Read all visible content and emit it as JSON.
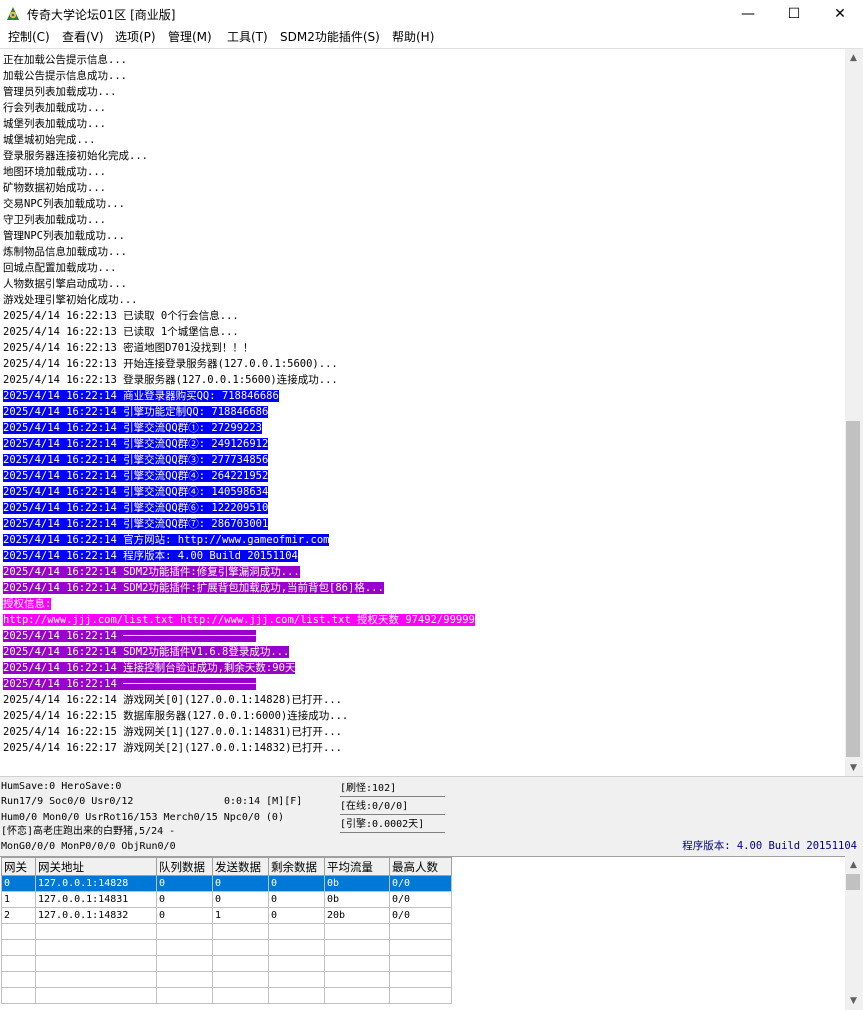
{
  "window": {
    "title": "传奇大学论坛01区 [商业版]",
    "min_glyph": "—",
    "max_glyph": "☐",
    "close_glyph": "✕"
  },
  "menu": [
    "控制(C)",
    "查看(V)",
    "选项(P)",
    "管理(M)",
    "工具(T)",
    "SDM2功能插件(S)",
    "帮助(H)"
  ],
  "log": [
    {
      "text": "正在加载公告提示信息...",
      "style": ""
    },
    {
      "text": "加载公告提示信息成功...",
      "style": ""
    },
    {
      "text": "管理员列表加载成功...",
      "style": ""
    },
    {
      "text": "行会列表加载成功...",
      "style": ""
    },
    {
      "text": "城堡列表加载成功...",
      "style": ""
    },
    {
      "text": "城堡城初始完成...",
      "style": ""
    },
    {
      "text": "登录服务器连接初始化完成...",
      "style": ""
    },
    {
      "text": "地图环境加载成功...",
      "style": ""
    },
    {
      "text": "矿物数据初始成功...",
      "style": ""
    },
    {
      "text": "交易NPC列表加载成功...",
      "style": ""
    },
    {
      "text": "守卫列表加载成功...",
      "style": ""
    },
    {
      "text": "管理NPC列表加载成功...",
      "style": ""
    },
    {
      "text": "炼制物品信息加载成功...",
      "style": ""
    },
    {
      "text": "回城点配置加载成功...",
      "style": ""
    },
    {
      "text": "人物数据引擎启动成功...",
      "style": ""
    },
    {
      "text": "游戏处理引擎初始化成功...",
      "style": ""
    },
    {
      "text": "2025/4/14 16:22:13 已读取 0个行会信息...",
      "style": ""
    },
    {
      "text": "2025/4/14 16:22:13 已读取 1个城堡信息...",
      "style": ""
    },
    {
      "text": "2025/4/14 16:22:13 密道地图D701没找到！！！",
      "style": ""
    },
    {
      "text": "2025/4/14 16:22:13 开始连接登录服务器(127.0.0.1:5600)...",
      "style": ""
    },
    {
      "text": "2025/4/14 16:22:13 登录服务器(127.0.0.1:5600)连接成功...",
      "style": ""
    },
    {
      "text": "2025/4/14 16:22:14 商业登录器购买QQ: 718846686",
      "style": "blue"
    },
    {
      "text": "2025/4/14 16:22:14 引擎功能定制QQ: 718846686",
      "style": "blue"
    },
    {
      "text": "2025/4/14 16:22:14 引擎交流QQ群①: 27299223",
      "style": "blue"
    },
    {
      "text": "2025/4/14 16:22:14 引擎交流QQ群②: 249126912",
      "style": "blue"
    },
    {
      "text": "2025/4/14 16:22:14 引擎交流QQ群③: 277734856",
      "style": "blue"
    },
    {
      "text": "2025/4/14 16:22:14 引擎交流QQ群④: 264221952",
      "style": "blue"
    },
    {
      "text": "2025/4/14 16:22:14 引擎交流QQ群④: 140598634",
      "style": "blue"
    },
    {
      "text": "2025/4/14 16:22:14 引擎交流QQ群⑥: 122209510",
      "style": "blue"
    },
    {
      "text": "2025/4/14 16:22:14 引擎交流QQ群⑦: 286703001",
      "style": "blue"
    },
    {
      "text": "2025/4/14 16:22:14 官方网站: http://www.gameofmir.com",
      "style": "blue"
    },
    {
      "text": "2025/4/14 16:22:14 程序版本: 4.00 Build 20151104",
      "style": "blue"
    },
    {
      "text": "2025/4/14 16:22:14 SDM2功能插件:修复引擎漏洞成功...",
      "style": "purple"
    },
    {
      "text": "2025/4/14 16:22:14 SDM2功能插件:扩展背包加载成功,当前背包[86]格...",
      "style": "purple"
    },
    {
      "text": "授权信息:",
      "style": "magenta"
    },
    {
      "text": "http://www.jjj.com/list.txt http://www.jjj.com/list.txt 授权天数 97492/99999",
      "style": "magenta"
    },
    {
      "text": "2025/4/14 16:22:14 ─────────────────────",
      "style": "purple"
    },
    {
      "text": "2025/4/14 16:22:14 SDM2功能插件V1.6.8登录成功...",
      "style": "purple"
    },
    {
      "text": "2025/4/14 16:22:14 连接控制台验证成功,剩余天数:90天",
      "style": "purple"
    },
    {
      "text": "2025/4/14 16:22:14 ─────────────────────",
      "style": "purple"
    },
    {
      "text": "2025/4/14 16:22:14 游戏网关[0](127.0.0.1:14828)已打开...",
      "style": ""
    },
    {
      "text": "2025/4/14 16:22:15 数据库服务器(127.0.0.1:6000)连接成功...",
      "style": ""
    },
    {
      "text": "2025/4/14 16:22:15 游戏网关[1](127.0.0.1:14831)已打开...",
      "style": ""
    },
    {
      "text": "2025/4/14 16:22:17 游戏网关[2](127.0.0.1:14832)已打开...",
      "style": ""
    }
  ],
  "status": {
    "line1": "HumSave:0 HeroSave:0",
    "line2": "Run17/9 Soc0/0 Usr0/12",
    "timer": "0:0:14 [M][F]",
    "line3": "Hum0/0 Mon0/0 UsrRot16/153 Merch0/15 Npc0/0 (0)",
    "line4": "[怀恋]高老庄跑出来的白野猪,5/24 -",
    "line5": "MonG0/0/0 MonP0/0/0 ObjRun0/0",
    "refresh": "[刷怪:102]",
    "online": "[在线:0/0/0]",
    "engine": "[引擎:0.0002天]",
    "version": "程序版本: 4.00 Build 20151104"
  },
  "grid": {
    "headers": [
      "网关",
      "网关地址",
      "队列数据",
      "发送数据",
      "剩余数据",
      "平均流量",
      "最高人数"
    ],
    "rows": [
      [
        "0",
        "127.0.0.1:14828",
        "0",
        "0",
        "0",
        "0b",
        "0/0"
      ],
      [
        "1",
        "127.0.0.1:14831",
        "0",
        "0",
        "0",
        "0b",
        "0/0"
      ],
      [
        "2",
        "127.0.0.1:14832",
        "0",
        "1",
        "0",
        "20b",
        "0/0"
      ]
    ],
    "selected_row": 0,
    "empty_rows": 5
  }
}
